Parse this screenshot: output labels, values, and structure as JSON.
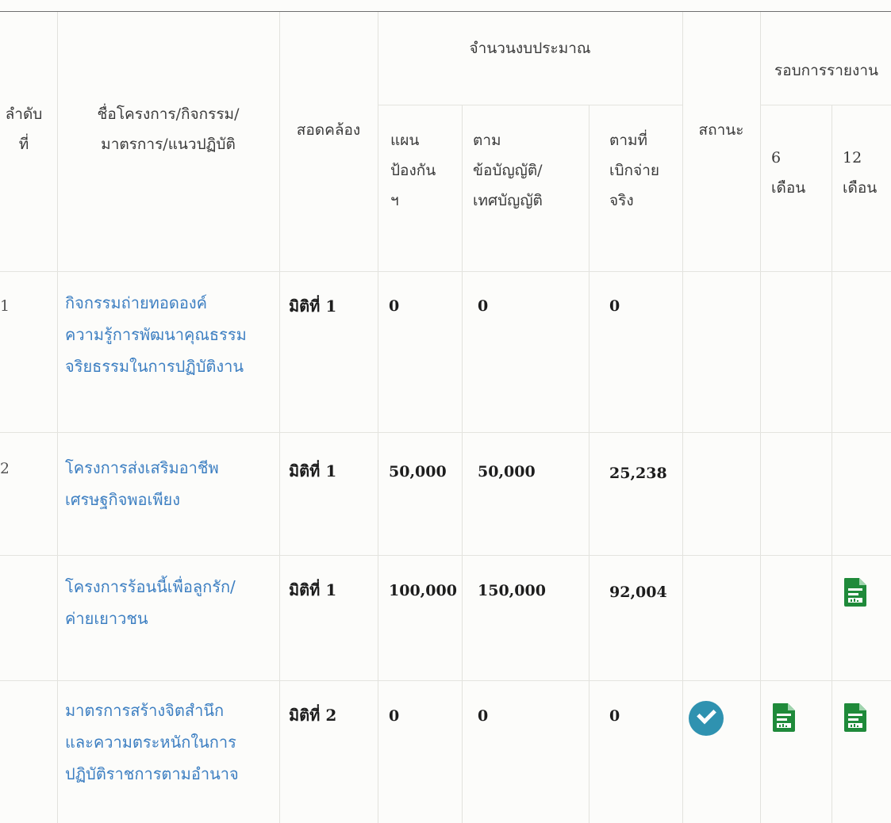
{
  "header": {
    "seq": "ลำดับ\nที่",
    "name": "ชื่อโครงการ/กิจกรรม/\nมาตรการ/แนวปฏิบัติ",
    "align": "สอดคล้อง",
    "budget_group": "จำนวนงบประมาณ",
    "budget_plan": "แผน\nป้องกัน\nฯ",
    "budget_regulation": "ตาม\nข้อบัญญัติ/\nเทศบัญญัติ",
    "budget_actual": "ตามที่\nเบิกจ่าย\nจริง",
    "status": "สถานะ",
    "report_group": "รอบการรายงาน",
    "report_6": "6\nเดือน",
    "report_12": "12\nเดือน"
  },
  "rows": [
    {
      "no": "1",
      "name": "กิจกรรมถ่ายทอดองค์\nความรู้การพัฒนาคุณธรรม\nจริยธรรมในการปฏิบัติงาน",
      "align": "มิติที่ 1",
      "plan": "0",
      "regulation": "0",
      "actual": "0",
      "status": "",
      "report_6": "",
      "report_12": ""
    },
    {
      "no": "2",
      "name": "โครงการส่งเสริมอาชีพ\nเศรษฐกิจพอเพียง",
      "align": "มิติที่ 1",
      "plan": "50,000",
      "regulation": "50,000",
      "actual": "25,238",
      "status": "",
      "report_6": "",
      "report_12": ""
    },
    {
      "no": "",
      "name": "โครงการร้อนนี้เพื่อลูกรัก/\nค่ายเยาวชน",
      "align": "มิติที่ 1",
      "plan": "100,000",
      "regulation": "150,000",
      "actual": "92,004",
      "status": "",
      "report_6": "",
      "report_12": "report-document-icon"
    },
    {
      "no": "",
      "name": "มาตรการสร้างจิตสำนึก\nและความตระหนักในการ\nปฏิบัติราชการตามอำนาจ",
      "align": "มิติที่ 2",
      "plan": "0",
      "regulation": "0",
      "actual": "0",
      "status": "check-circle-icon",
      "report_6": "report-document-icon",
      "report_12": "report-document-icon"
    }
  ],
  "colors": {
    "link": "#3d7fc2",
    "status_ok": "#2f92b0",
    "document": "#1f8a3a"
  }
}
